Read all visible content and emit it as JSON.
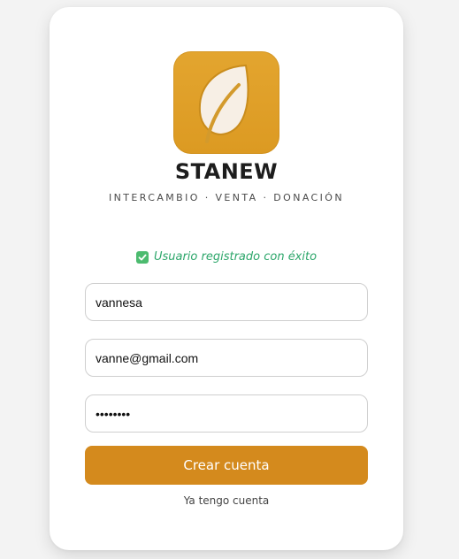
{
  "app": {
    "title": "STANEW",
    "tagline": "INTERCAMBIO · VENTA · DONACIÓN",
    "logo_icon": "leaf-icon"
  },
  "status": {
    "message": "Usuario registrado con éxito",
    "icon": "check-box-icon",
    "color": "#2ca66a"
  },
  "form": {
    "username_value": "vannesa",
    "email_value": "vanne@gmail.com",
    "password_value": "12345678",
    "submit_label": "Crear cuenta",
    "login_link": "Ya tengo cuenta"
  },
  "colors": {
    "accent": "#d48a1d",
    "logo_bg": "#e0a02a",
    "background": "#f3f3f3"
  }
}
